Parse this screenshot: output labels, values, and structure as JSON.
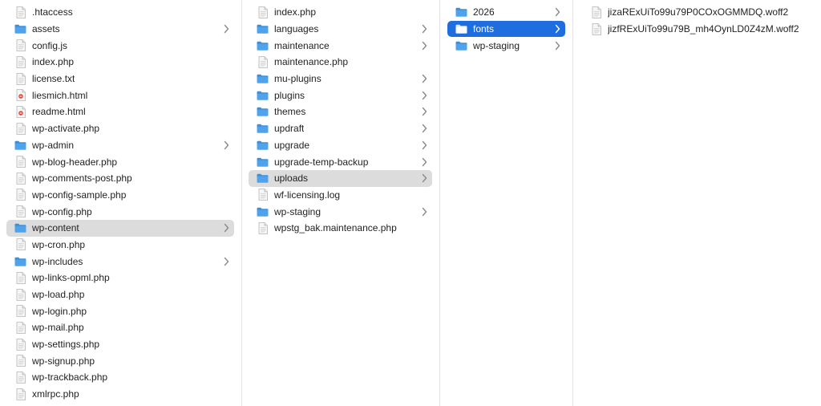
{
  "colors": {
    "folder": "#4fa3ec",
    "selected_active": "#1f6ee0",
    "selected_inactive": "#dcdcdc",
    "chevron": "#8a8a8a"
  },
  "columns": [
    {
      "name": "root",
      "items": [
        {
          "label": ".htaccess",
          "kind": "doc",
          "chevron": false,
          "selected": ""
        },
        {
          "label": "assets",
          "kind": "folder",
          "chevron": true,
          "selected": ""
        },
        {
          "label": "config.js",
          "kind": "doc",
          "chevron": false,
          "selected": ""
        },
        {
          "label": "index.php",
          "kind": "doc",
          "chevron": false,
          "selected": ""
        },
        {
          "label": "license.txt",
          "kind": "doc",
          "chevron": false,
          "selected": ""
        },
        {
          "label": "liesmich.html",
          "kind": "html",
          "chevron": false,
          "selected": ""
        },
        {
          "label": "readme.html",
          "kind": "html",
          "chevron": false,
          "selected": ""
        },
        {
          "label": "wp-activate.php",
          "kind": "doc",
          "chevron": false,
          "selected": ""
        },
        {
          "label": "wp-admin",
          "kind": "folder",
          "chevron": true,
          "selected": ""
        },
        {
          "label": "wp-blog-header.php",
          "kind": "doc",
          "chevron": false,
          "selected": ""
        },
        {
          "label": "wp-comments-post.php",
          "kind": "doc",
          "chevron": false,
          "selected": ""
        },
        {
          "label": "wp-config-sample.php",
          "kind": "doc",
          "chevron": false,
          "selected": ""
        },
        {
          "label": "wp-config.php",
          "kind": "doc",
          "chevron": false,
          "selected": ""
        },
        {
          "label": "wp-content",
          "kind": "folder",
          "chevron": true,
          "selected": "gray"
        },
        {
          "label": "wp-cron.php",
          "kind": "doc",
          "chevron": false,
          "selected": ""
        },
        {
          "label": "wp-includes",
          "kind": "folder",
          "chevron": true,
          "selected": ""
        },
        {
          "label": "wp-links-opml.php",
          "kind": "doc",
          "chevron": false,
          "selected": ""
        },
        {
          "label": "wp-load.php",
          "kind": "doc",
          "chevron": false,
          "selected": ""
        },
        {
          "label": "wp-login.php",
          "kind": "doc",
          "chevron": false,
          "selected": ""
        },
        {
          "label": "wp-mail.php",
          "kind": "doc",
          "chevron": false,
          "selected": ""
        },
        {
          "label": "wp-settings.php",
          "kind": "doc",
          "chevron": false,
          "selected": ""
        },
        {
          "label": "wp-signup.php",
          "kind": "doc",
          "chevron": false,
          "selected": ""
        },
        {
          "label": "wp-trackback.php",
          "kind": "doc",
          "chevron": false,
          "selected": ""
        },
        {
          "label": "xmlrpc.php",
          "kind": "doc",
          "chevron": false,
          "selected": ""
        }
      ]
    },
    {
      "name": "wp-content",
      "items": [
        {
          "label": "index.php",
          "kind": "doc",
          "chevron": false,
          "selected": ""
        },
        {
          "label": "languages",
          "kind": "folder",
          "chevron": true,
          "selected": ""
        },
        {
          "label": "maintenance",
          "kind": "folder",
          "chevron": true,
          "selected": ""
        },
        {
          "label": "maintenance.php",
          "kind": "doc",
          "chevron": false,
          "selected": ""
        },
        {
          "label": "mu-plugins",
          "kind": "folder",
          "chevron": true,
          "selected": ""
        },
        {
          "label": "plugins",
          "kind": "folder",
          "chevron": true,
          "selected": ""
        },
        {
          "label": "themes",
          "kind": "folder",
          "chevron": true,
          "selected": ""
        },
        {
          "label": "updraft",
          "kind": "folder",
          "chevron": true,
          "selected": ""
        },
        {
          "label": "upgrade",
          "kind": "folder",
          "chevron": true,
          "selected": ""
        },
        {
          "label": "upgrade-temp-backup",
          "kind": "folder",
          "chevron": true,
          "selected": ""
        },
        {
          "label": "uploads",
          "kind": "folder",
          "chevron": true,
          "selected": "gray"
        },
        {
          "label": "wf-licensing.log",
          "kind": "doc",
          "chevron": false,
          "selected": ""
        },
        {
          "label": "wp-staging",
          "kind": "folder",
          "chevron": true,
          "selected": ""
        },
        {
          "label": "wpstg_bak.maintenance.php",
          "kind": "doc",
          "chevron": false,
          "selected": ""
        }
      ]
    },
    {
      "name": "uploads",
      "items": [
        {
          "label": "2026",
          "kind": "folder",
          "chevron": true,
          "selected": ""
        },
        {
          "label": "fonts",
          "kind": "folder",
          "chevron": true,
          "selected": "blue"
        },
        {
          "label": "wp-staging",
          "kind": "folder",
          "chevron": true,
          "selected": ""
        }
      ]
    },
    {
      "name": "fonts",
      "items": [
        {
          "label": "jizaRExUiTo99u79P0COxOGMMDQ.woff2",
          "kind": "doc",
          "chevron": false,
          "selected": ""
        },
        {
          "label": "jizfRExUiTo99u79B_mh4OynLD0Z4zM.woff2",
          "kind": "doc",
          "chevron": false,
          "selected": ""
        }
      ]
    }
  ]
}
